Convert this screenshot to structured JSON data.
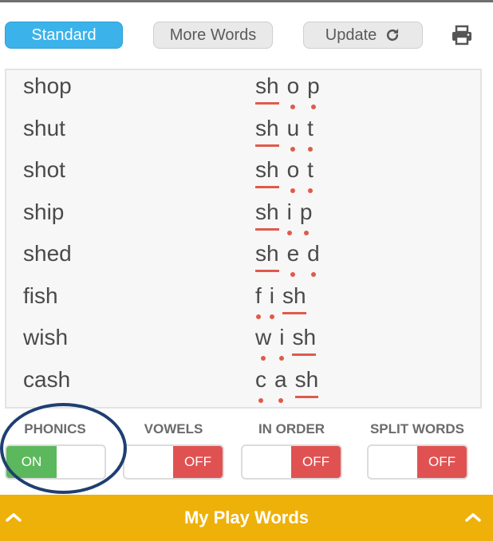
{
  "toolbar": {
    "standard_label": "Standard",
    "more_words_label": "More Words",
    "update_label": "Update",
    "update_icon": "refresh-icon",
    "print_icon": "printer-icon"
  },
  "words": [
    {
      "word": "shop",
      "segments": [
        {
          "text": "sh",
          "type": "digraph"
        },
        {
          "text": "o",
          "type": "single"
        },
        {
          "text": "p",
          "type": "single"
        }
      ]
    },
    {
      "word": "shut",
      "segments": [
        {
          "text": "sh",
          "type": "digraph"
        },
        {
          "text": "u",
          "type": "single"
        },
        {
          "text": "t",
          "type": "single"
        }
      ]
    },
    {
      "word": "shot",
      "segments": [
        {
          "text": "sh",
          "type": "digraph"
        },
        {
          "text": "o",
          "type": "single"
        },
        {
          "text": "t",
          "type": "single"
        }
      ]
    },
    {
      "word": "ship",
      "segments": [
        {
          "text": "sh",
          "type": "digraph"
        },
        {
          "text": "i",
          "type": "single"
        },
        {
          "text": "p",
          "type": "single"
        }
      ]
    },
    {
      "word": "shed",
      "segments": [
        {
          "text": "sh",
          "type": "digraph"
        },
        {
          "text": "e",
          "type": "single"
        },
        {
          "text": "d",
          "type": "single"
        }
      ]
    },
    {
      "word": "fish",
      "segments": [
        {
          "text": "f",
          "type": "single"
        },
        {
          "text": "i",
          "type": "single"
        },
        {
          "text": "sh",
          "type": "digraph"
        }
      ]
    },
    {
      "word": "wish",
      "segments": [
        {
          "text": "w",
          "type": "single"
        },
        {
          "text": "i",
          "type": "single"
        },
        {
          "text": "sh",
          "type": "digraph"
        }
      ]
    },
    {
      "word": "cash",
      "segments": [
        {
          "text": "c",
          "type": "single"
        },
        {
          "text": "a",
          "type": "single"
        },
        {
          "text": "sh",
          "type": "digraph"
        }
      ]
    }
  ],
  "toggles": [
    {
      "label": "PHONICS",
      "state": "ON"
    },
    {
      "label": "VOWELS",
      "state": "OFF"
    },
    {
      "label": "IN ORDER",
      "state": "OFF"
    },
    {
      "label": "SPLIT WORDS",
      "state": "OFF"
    }
  ],
  "bottom_bar": {
    "title": "My Play Words",
    "left_icon": "chevron-up-icon",
    "right_icon": "chevron-up-icon"
  },
  "colors": {
    "standard_button": "#3bb3ea",
    "toggle_on": "#5cb85c",
    "toggle_off": "#e05252",
    "phonics_marker": "#e05a4c",
    "bottom_bar": "#eeb10a",
    "highlight_ring": "#1e3f73"
  }
}
